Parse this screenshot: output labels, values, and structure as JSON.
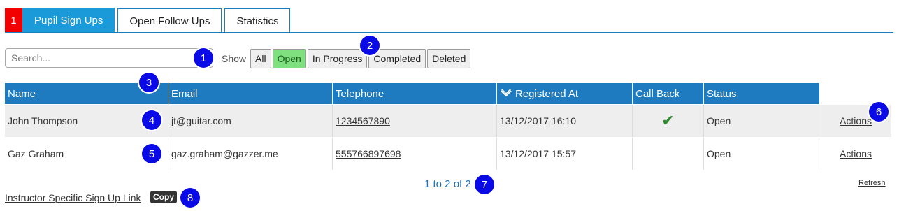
{
  "tabs": {
    "marker": "1",
    "items": [
      "Pupil Sign Ups",
      "Open Follow Ups",
      "Statistics"
    ]
  },
  "search": {
    "placeholder": "Search..."
  },
  "filters": {
    "show_label": "Show",
    "buttons": [
      "All",
      "Open",
      "In Progress",
      "Completed",
      "Deleted"
    ],
    "active": "Open",
    "active_color": "#7ee07e"
  },
  "table": {
    "headers": [
      "Name",
      "Email",
      "Telephone",
      "Registered At",
      "Call Back",
      "Status"
    ],
    "sort_icon": "chevron-down-icon",
    "rows": [
      {
        "name": "John Thompson",
        "email": "jt@guitar.com",
        "telephone": "1234567890",
        "registered_at": "13/12/2017 16:10",
        "call_back": "✔",
        "status": "Open",
        "action": "Actions"
      },
      {
        "name": "Gaz Graham",
        "email": "gaz.graham@gazzer.me",
        "telephone": "555766897698",
        "registered_at": "13/12/2017 15:57",
        "call_back": "",
        "status": "Open",
        "action": "Actions"
      }
    ]
  },
  "pager": "1 to 2 of 2",
  "refresh": "Refresh",
  "footer": {
    "link": "Instructor Specific Sign Up Link",
    "copy": "Copy"
  },
  "badges": [
    "1",
    "2",
    "3",
    "4",
    "5",
    "6",
    "7",
    "8"
  ],
  "colors": {
    "header": "#1e7bbf",
    "tab_active": "#1a9ad9",
    "marker": "#f20000",
    "badge": "#0a0ae6"
  }
}
